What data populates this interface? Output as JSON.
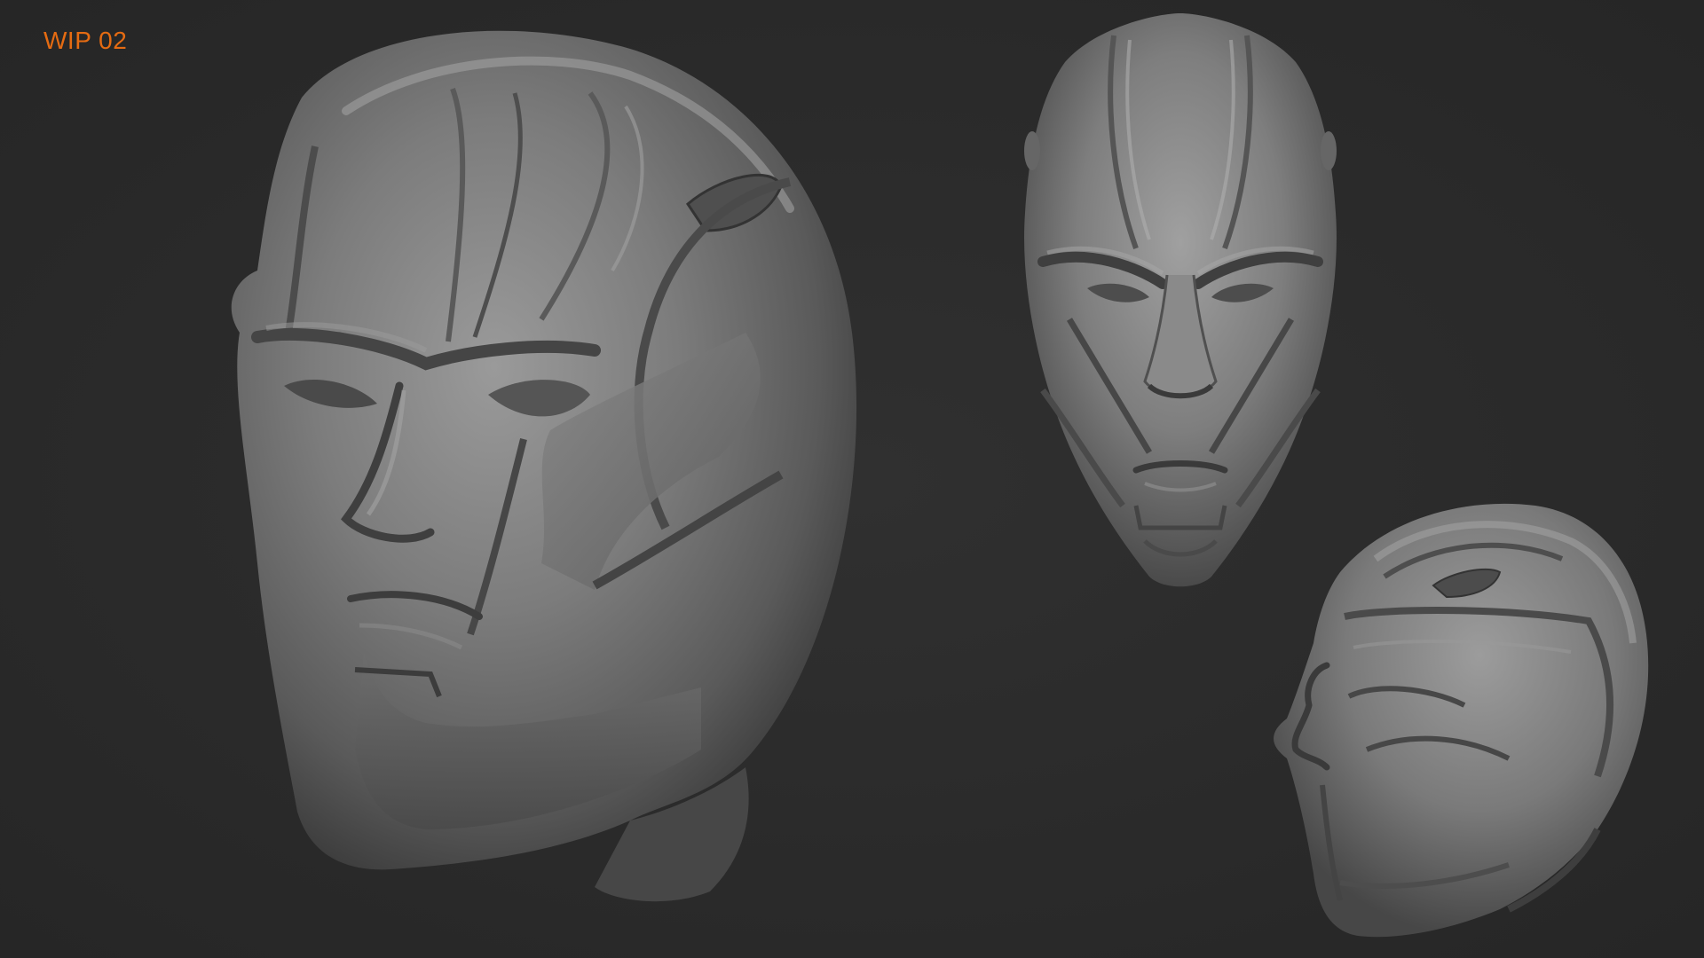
{
  "label": {
    "text": "WIP 02",
    "color": "#e56b12"
  },
  "background_color": "#2b2b2b",
  "views": [
    {
      "name": "three-quarter-view",
      "description_icon": "sculpt-head-three-quarter"
    },
    {
      "name": "front-view",
      "description_icon": "sculpt-head-front"
    },
    {
      "name": "side-view",
      "description_icon": "sculpt-head-profile"
    }
  ]
}
